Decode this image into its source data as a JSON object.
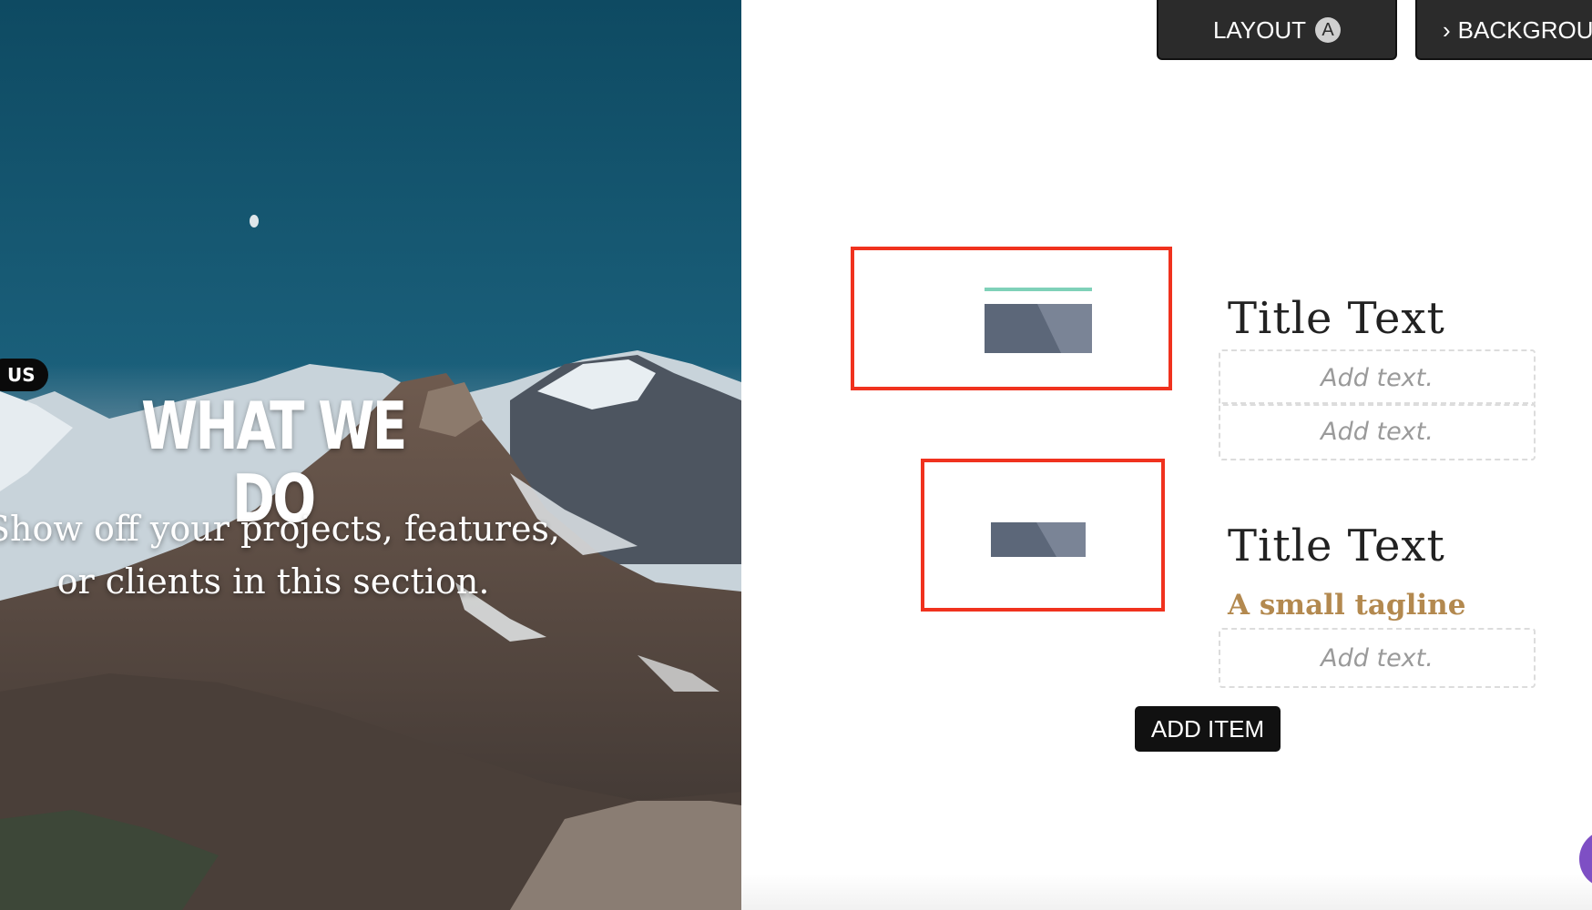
{
  "hero": {
    "badge": "US",
    "title": "WHAT WE DO",
    "subtitle": "Show off your projects, features, or clients in this section."
  },
  "toolbar": {
    "layout_label": "LAYOUT",
    "layout_badge": "A",
    "background_label": "BACKGROU"
  },
  "items": [
    {
      "title": "Title Text",
      "text_fields": [
        "Add text.",
        "Add text."
      ]
    },
    {
      "title": "Title Text",
      "tagline": "A small tagline",
      "text_fields": [
        "Add text."
      ]
    }
  ],
  "add_item_label": "ADD ITEM",
  "colors": {
    "highlight_border": "#f0321e",
    "tagline": "#b3894f",
    "accent_line": "#7fd1b9",
    "placeholder_image": "#5c6779",
    "fab": "#7e4fc4"
  }
}
